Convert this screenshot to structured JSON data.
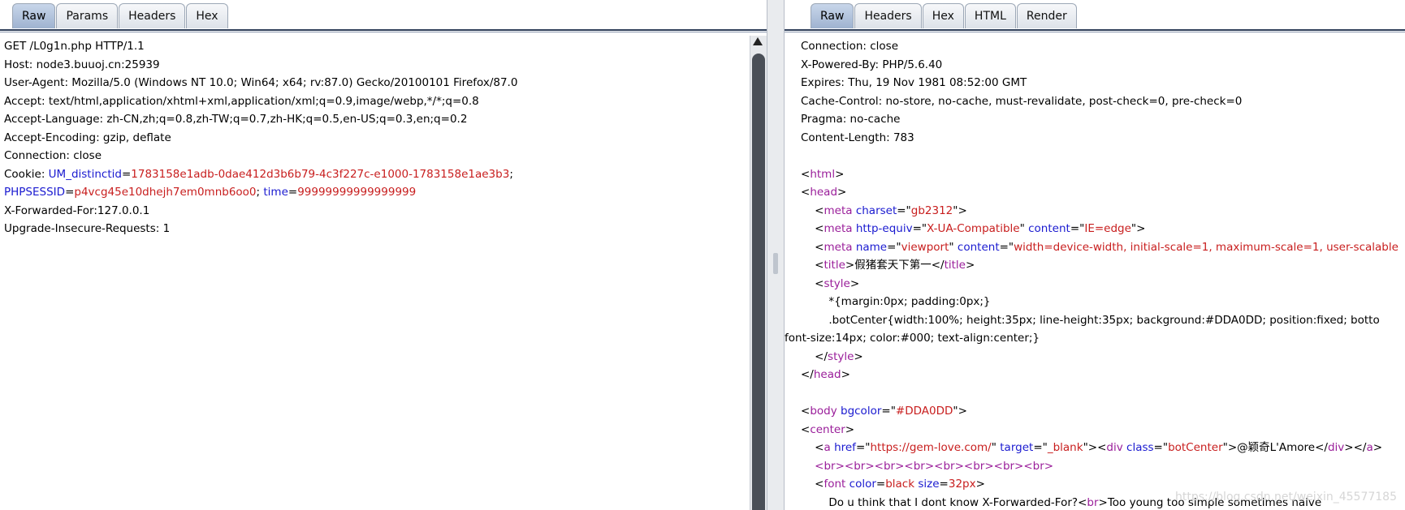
{
  "request": {
    "tabs": [
      {
        "label": "Raw",
        "active": true
      },
      {
        "label": "Params",
        "active": false
      },
      {
        "label": "Headers",
        "active": false
      },
      {
        "label": "Hex",
        "active": false
      }
    ],
    "lines": [
      "GET /L0g1n.php HTTP/1.1",
      "Host: node3.buuoj.cn:25939",
      "User-Agent: Mozilla/5.0 (Windows NT 10.0; Win64; x64; rv:87.0) Gecko/20100101 Firefox/87.0",
      "Accept: text/html,application/xhtml+xml,application/xml;q=0.9,image/webp,*/*;q=0.8",
      "Accept-Language: zh-CN,zh;q=0.8,zh-TW;q=0.7,zh-HK;q=0.5,en-US;q=0.3,en;q=0.2",
      "Accept-Encoding: gzip, deflate",
      "Connection: close"
    ],
    "cookie": {
      "prefix": "Cookie: ",
      "um_name": "UM_distinctid",
      "um_value": "1783158e1adb-0dae412d3b6b79-4c3f227c-e1000-1783158e1ae3b3",
      "sess_name": "PHPSESSID",
      "sess_value": "p4vcg45e10dhejh7em0mnb6oo0",
      "time_name": "time",
      "time_value": "99999999999999999"
    },
    "lines_after": [
      "X-Forwarded-For:127.0.0.1",
      "Upgrade-Insecure-Requests: 1"
    ]
  },
  "response": {
    "tabs": [
      {
        "label": "Raw",
        "active": true
      },
      {
        "label": "Headers",
        "active": false
      },
      {
        "label": "Hex",
        "active": false
      },
      {
        "label": "HTML",
        "active": false
      },
      {
        "label": "Render",
        "active": false
      }
    ],
    "headers": [
      "Connection: close",
      "X-Powered-By: PHP/5.6.40",
      "Expires: Thu, 19 Nov 1981 08:52:00 GMT",
      "Cache-Control: no-store, no-cache, must-revalidate, post-check=0, pre-check=0",
      "Pragma: no-cache",
      "Content-Length: 783"
    ],
    "html": {
      "html_tag": "html",
      "head_tag": "head",
      "meta1_charset": "gb2312",
      "meta2_equiv": "X-UA-Compatible",
      "meta2_content": "IE=edge",
      "meta3_name": "viewport",
      "meta3_content": "width=device-width, initial-scale=1, maximum-scale=1, user-scalable",
      "title_text": "假猪套天下第一",
      "style_line1": "*{margin:0px; padding:0px;}",
      "style_line2": ".botCenter{width:100%; height:35px; line-height:35px; background:#DDA0DD; position:fixed; botto",
      "style_line3": "font-size:14px; color:#000; text-align:center;}",
      "body_bgcolor": "#DDA0DD",
      "center_tag": "center",
      "a_href": "https://gem-love.com/",
      "a_target": "_blank",
      "div_class": "botCenter",
      "div_text": "@颖奇L'Amore",
      "br_tags": "<br><br><br><br><br><br><br><br>",
      "font_color": "black",
      "font_size": "32px",
      "last_line_a": "Do u think that I dont know X-Forwarded-For?",
      "last_line_b": "Too young too simple sometimes naive"
    }
  },
  "watermark": "https://blog.csdn.net/weixin_45577185"
}
